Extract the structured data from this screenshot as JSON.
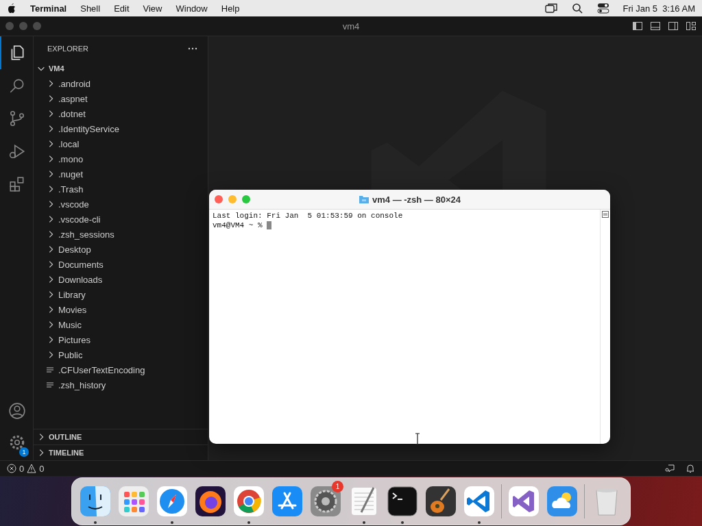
{
  "menubar": {
    "app": "Terminal",
    "menus": [
      "Shell",
      "Edit",
      "View",
      "Window",
      "Help"
    ],
    "clock": "Fri Jan 5  3:16 AM"
  },
  "editor_window": {
    "title": "vm4",
    "activity": [
      {
        "kind": "explorer",
        "selected": true
      },
      {
        "kind": "search",
        "selected": false
      },
      {
        "kind": "source-control",
        "selected": false
      },
      {
        "kind": "run-debug",
        "selected": false
      },
      {
        "kind": "extensions",
        "selected": false
      }
    ],
    "settings_badge": "1",
    "sidebar": {
      "title": "EXPLORER",
      "root": {
        "label": "VM4",
        "expanded": true,
        "children": [
          {
            "label": ".android",
            "kind": "folder"
          },
          {
            "label": ".aspnet",
            "kind": "folder"
          },
          {
            "label": ".dotnet",
            "kind": "folder"
          },
          {
            "label": ".IdentityService",
            "kind": "folder"
          },
          {
            "label": ".local",
            "kind": "folder"
          },
          {
            "label": ".mono",
            "kind": "folder"
          },
          {
            "label": ".nuget",
            "kind": "folder"
          },
          {
            "label": ".Trash",
            "kind": "folder"
          },
          {
            "label": ".vscode",
            "kind": "folder"
          },
          {
            "label": ".vscode-cli",
            "kind": "folder"
          },
          {
            "label": ".zsh_sessions",
            "kind": "folder"
          },
          {
            "label": "Desktop",
            "kind": "folder"
          },
          {
            "label": "Documents",
            "kind": "folder"
          },
          {
            "label": "Downloads",
            "kind": "folder"
          },
          {
            "label": "Library",
            "kind": "folder"
          },
          {
            "label": "Movies",
            "kind": "folder"
          },
          {
            "label": "Music",
            "kind": "folder"
          },
          {
            "label": "Pictures",
            "kind": "folder"
          },
          {
            "label": "Public",
            "kind": "folder"
          },
          {
            "label": ".CFUserTextEncoding",
            "kind": "file"
          },
          {
            "label": ".zsh_history",
            "kind": "file"
          }
        ]
      },
      "sections": [
        {
          "label": "OUTLINE",
          "expanded": false
        },
        {
          "label": "TIMELINE",
          "expanded": false
        }
      ]
    },
    "status_bar": {
      "errors": "0",
      "warnings": "0"
    }
  },
  "terminal_window": {
    "title": "vm4 — -zsh — 80×24",
    "lines": [
      "Last login: Fri Jan  5 01:53:59 on console"
    ],
    "prompt": "vm4@VM4 ~ % "
  },
  "dock": {
    "items": [
      {
        "kind": "finder",
        "running": true
      },
      {
        "kind": "launchpad",
        "running": false
      },
      {
        "kind": "safari",
        "running": true
      },
      {
        "kind": "firefox",
        "running": false
      },
      {
        "kind": "chrome",
        "running": true
      },
      {
        "kind": "appstore",
        "running": false
      },
      {
        "kind": "settings",
        "running": false,
        "badge": "1"
      },
      {
        "kind": "textedit",
        "running": true
      },
      {
        "kind": "terminal",
        "running": true
      },
      {
        "kind": "garageband",
        "running": false
      },
      {
        "kind": "vscode",
        "running": true
      },
      {
        "kind": "separator"
      },
      {
        "kind": "visualstudio",
        "running": false
      },
      {
        "kind": "weather",
        "running": false
      },
      {
        "kind": "separator"
      },
      {
        "kind": "trash",
        "running": false
      }
    ]
  }
}
